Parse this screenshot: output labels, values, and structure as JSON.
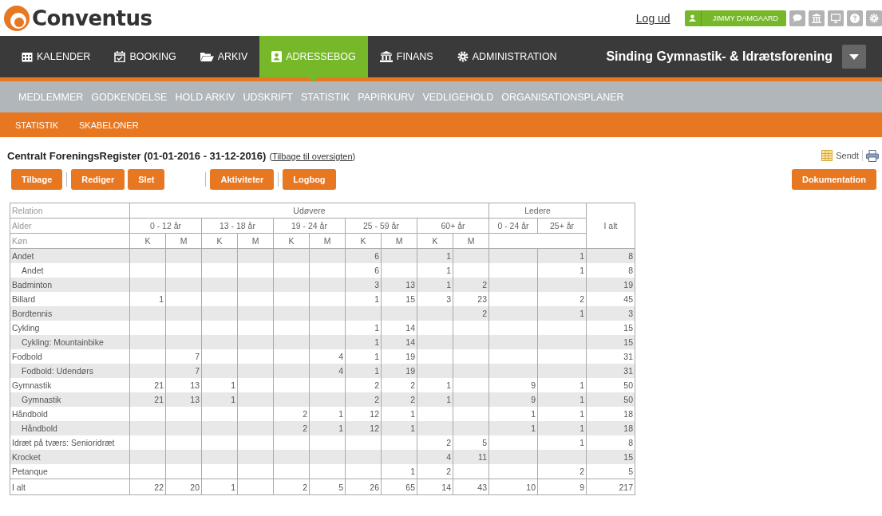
{
  "logo": {
    "text": "Conventus"
  },
  "top_bar": {
    "logout": "Log ud",
    "user": "JIMMY DAMGAARD"
  },
  "nav": [
    {
      "label": "KALENDER",
      "selected": false
    },
    {
      "label": "BOOKING",
      "selected": false
    },
    {
      "label": "ARKIV",
      "selected": false
    },
    {
      "label": "ADRESSEBOG",
      "selected": true
    },
    {
      "label": "FINANS",
      "selected": false
    },
    {
      "label": "ADMINISTRATION",
      "selected": false
    }
  ],
  "organization": "Sinding Gymnastik- & Idrætsforening",
  "subnav": [
    "MEDLEMMER",
    "GODKENDELSE",
    "HOLD ARKIV",
    "UDSKRIFT",
    "STATISTIK",
    "PAPIRKURV",
    "VEDLIGEHOLD",
    "ORGANISATIONSPLANER"
  ],
  "subsubnav": [
    "STATISTIK",
    "SKABELONER"
  ],
  "page_title": "Centralt ForeningsRegister (01-01-2016 - 31-12-2016)",
  "back_open": "(",
  "back_link": "Tilbage til oversigten",
  "back_close": ")",
  "sent_label": "Sendt",
  "button_groups": [
    [
      "Tilbage"
    ],
    [
      "Rediger",
      "Slet"
    ],
    [
      "Aktiviteter"
    ],
    [
      "Logbog"
    ]
  ],
  "doc_button": "Dokumentation",
  "table": {
    "relation_label": "Relation",
    "age_label": "Alder",
    "gender_label": "Køn",
    "total_label": "I alt",
    "groups": [
      {
        "label": "Udøvere",
        "ages": [
          {
            "label": "0 - 12 år",
            "genders": [
              "K",
              "M"
            ]
          },
          {
            "label": "13 - 18 år",
            "genders": [
              "K",
              "M"
            ]
          },
          {
            "label": "19 - 24 år",
            "genders": [
              "K",
              "M"
            ]
          },
          {
            "label": "25 - 59 år",
            "genders": [
              "K",
              "M"
            ]
          },
          {
            "label": "60+ år",
            "genders": [
              "K",
              "M"
            ]
          }
        ]
      },
      {
        "label": "Ledere",
        "ages": [
          {
            "label": "0 - 24 år"
          },
          {
            "label": "25+ år"
          }
        ]
      }
    ],
    "rows": [
      {
        "name": "Andet",
        "values": {
          "u25_59_k": "6",
          "u60_k": "1",
          "l25": "1",
          "total": "8"
        },
        "children": [
          {
            "name": "Andet",
            "values": {
              "u25_59_k": "6",
              "u60_k": "1",
              "l25": "1",
              "total": "8"
            }
          }
        ]
      },
      {
        "name": "Badminton",
        "values": {
          "u25_59_k": "3",
          "u25_59_m": "13",
          "u60_k": "1",
          "u60_m": "2",
          "total": "19"
        }
      },
      {
        "name": "Billard",
        "values": {
          "u0_12_k": "1",
          "u25_59_k": "1",
          "u25_59_m": "15",
          "u60_k": "3",
          "u60_m": "23",
          "l25": "2",
          "total": "45"
        }
      },
      {
        "name": "Bordtennis",
        "values": {
          "u60_m": "2",
          "l25": "1",
          "total": "3"
        }
      },
      {
        "name": "Cykling",
        "values": {
          "u25_59_k": "1",
          "u25_59_m": "14",
          "total": "15"
        },
        "children": [
          {
            "name": "Cykling: Mountainbike",
            "values": {
              "u25_59_k": "1",
              "u25_59_m": "14",
              "total": "15"
            }
          }
        ]
      },
      {
        "name": "Fodbold",
        "values": {
          "u0_12_m": "7",
          "u19_24_m": "4",
          "u25_59_k": "1",
          "u25_59_m": "19",
          "total": "31"
        },
        "children": [
          {
            "name": "Fodbold: Udendørs",
            "values": {
              "u0_12_m": "7",
              "u19_24_m": "4",
              "u25_59_k": "1",
              "u25_59_m": "19",
              "total": "31"
            }
          }
        ]
      },
      {
        "name": "Gymnastik",
        "values": {
          "u0_12_k": "21",
          "u0_12_m": "13",
          "u13_18_k": "1",
          "u25_59_k": "2",
          "u25_59_m": "2",
          "u60_k": "1",
          "l0_24": "9",
          "l25": "1",
          "total": "50"
        },
        "children": [
          {
            "name": "Gymnastik",
            "values": {
              "u0_12_k": "21",
              "u0_12_m": "13",
              "u13_18_k": "1",
              "u25_59_k": "2",
              "u25_59_m": "2",
              "u60_k": "1",
              "l0_24": "9",
              "l25": "1",
              "total": "50"
            }
          }
        ]
      },
      {
        "name": "Håndbold",
        "values": {
          "u19_24_k": "2",
          "u19_24_m": "1",
          "u25_59_k": "12",
          "u25_59_m": "1",
          "l0_24": "1",
          "l25": "1",
          "total": "18"
        },
        "children": [
          {
            "name": "Håndbold",
            "values": {
              "u19_24_k": "2",
              "u19_24_m": "1",
              "u25_59_k": "12",
              "u25_59_m": "1",
              "l0_24": "1",
              "l25": "1",
              "total": "18"
            }
          }
        ]
      },
      {
        "name": "Idræt på tværs: Senioridræt",
        "values": {
          "u60_k": "2",
          "u60_m": "5",
          "l25": "1",
          "total": "8"
        }
      },
      {
        "name": "Krocket",
        "values": {
          "u60_k": "4",
          "u60_m": "11",
          "total": "15"
        }
      },
      {
        "name": "Petanque",
        "values": {
          "u25_59_m": "1",
          "u60_k": "2",
          "l25": "2",
          "total": "5"
        }
      }
    ],
    "total_row": {
      "name": "I alt",
      "values": {
        "u0_12_k": "22",
        "u0_12_m": "20",
        "u13_18_k": "1",
        "u19_24_k": "2",
        "u19_24_m": "5",
        "u25_59_k": "26",
        "u25_59_m": "65",
        "u60_k": "14",
        "u60_m": "43",
        "l0_24": "10",
        "l25": "9",
        "total": "217"
      }
    }
  }
}
